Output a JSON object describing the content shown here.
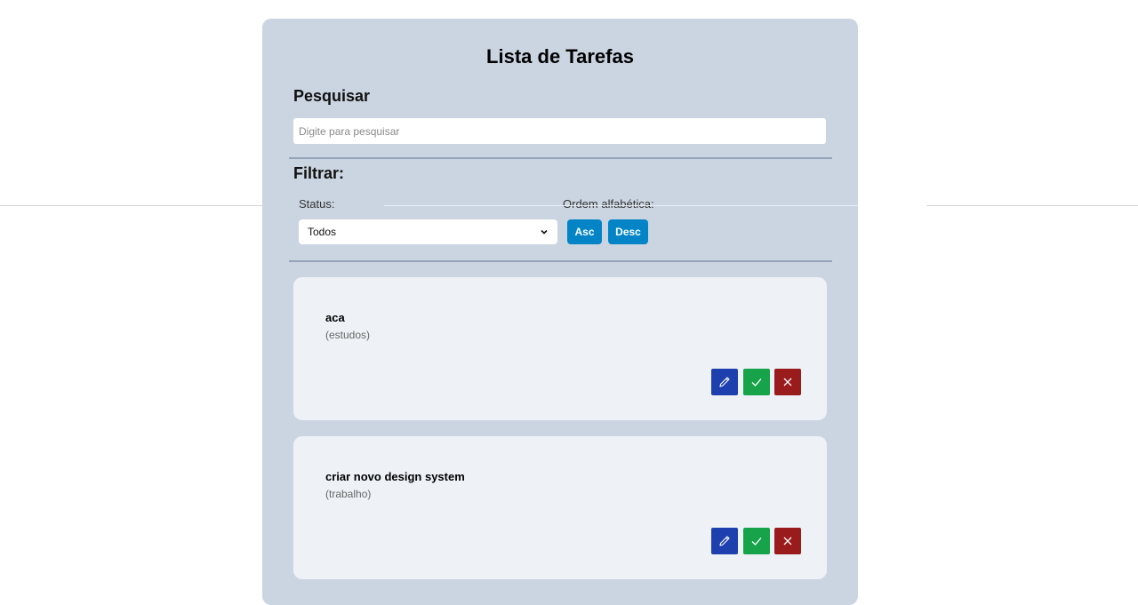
{
  "app": {
    "title": "Lista de Tarefas"
  },
  "search": {
    "heading": "Pesquisar",
    "placeholder": "Digite para pesquisar",
    "value": ""
  },
  "filter": {
    "heading": "Filtrar:",
    "status_label": "Status:",
    "status_selected": "Todos",
    "order_label": "Ordem alfabética:",
    "asc_label": "Asc",
    "desc_label": "Desc"
  },
  "todos": [
    {
      "title": "aca",
      "category": "(estudos)"
    },
    {
      "title": "criar novo design system",
      "category": "(trabalho)"
    }
  ],
  "icons": {
    "edit": "pencil-icon",
    "complete": "check-icon",
    "remove": "close-icon",
    "select": "chevron-down-icon"
  },
  "colors": {
    "panel": "#cbd5e1",
    "card": "#eef2f7",
    "sort_button": "#0284c7",
    "edit_button": "#1e40af",
    "complete_button": "#16a34a",
    "remove_button": "#991b1b"
  }
}
